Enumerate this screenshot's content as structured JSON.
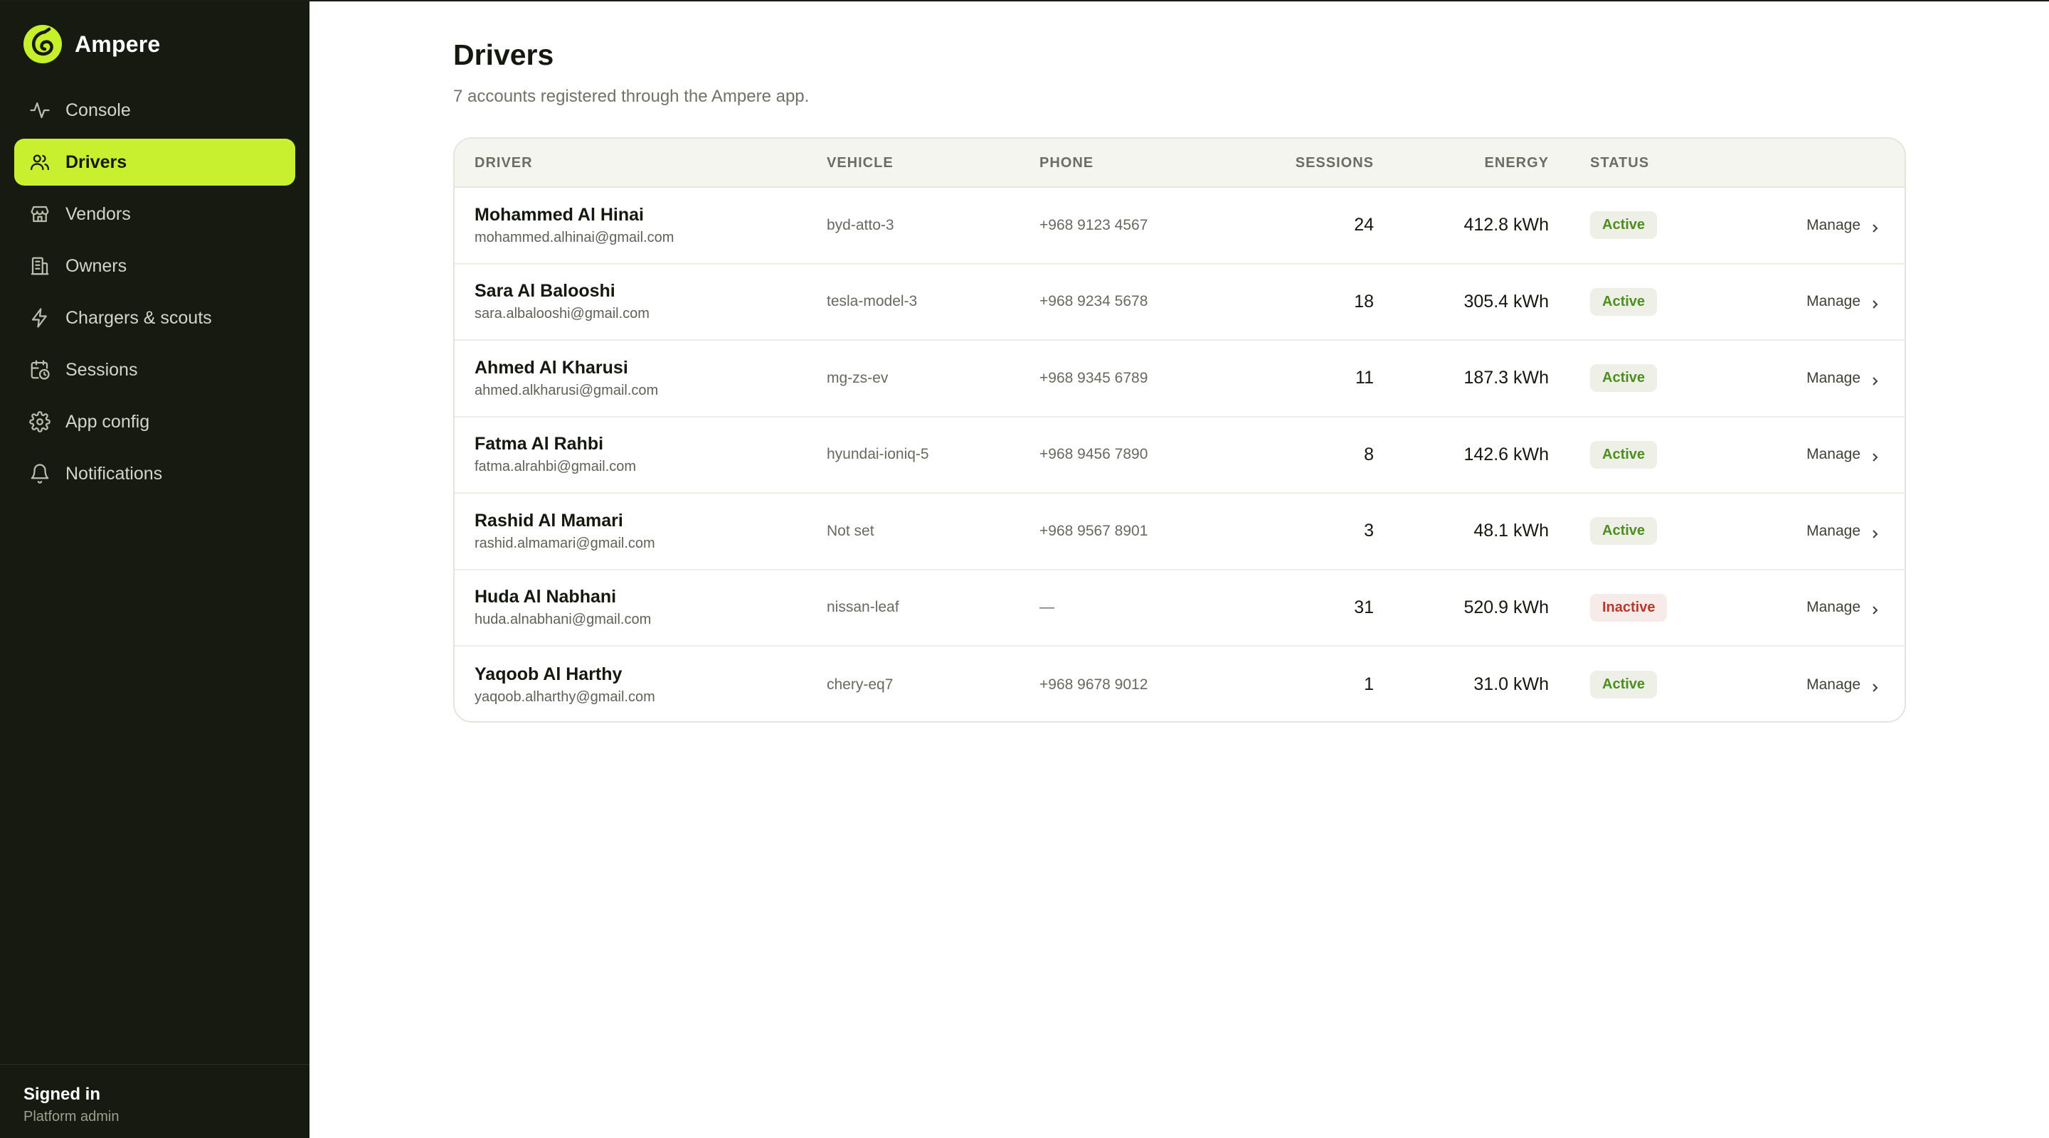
{
  "app": {
    "name": "Ampere"
  },
  "sidebar": {
    "items": [
      {
        "label": "Console",
        "icon": "activity-icon"
      },
      {
        "label": "Drivers",
        "icon": "users-icon",
        "active": true
      },
      {
        "label": "Vendors",
        "icon": "store-icon"
      },
      {
        "label": "Owners",
        "icon": "building-icon"
      },
      {
        "label": "Chargers & scouts",
        "icon": "bolt-icon"
      },
      {
        "label": "Sessions",
        "icon": "calendar-clock-icon"
      },
      {
        "label": "App config",
        "icon": "gear-icon"
      },
      {
        "label": "Notifications",
        "icon": "bell-icon"
      }
    ],
    "footer": {
      "title": "Signed in",
      "subtitle": "Platform admin"
    }
  },
  "page": {
    "title": "Drivers",
    "subtitle": "7 accounts registered through the Ampere app."
  },
  "table": {
    "columns": {
      "driver": "DRIVER",
      "vehicle": "VEHICLE",
      "phone": "PHONE",
      "sessions": "SESSIONS",
      "energy": "ENERGY",
      "status": "STATUS"
    },
    "action_label": "Manage",
    "rows": [
      {
        "name": "Mohammed Al Hinai",
        "email": "mohammed.alhinai@gmail.com",
        "vehicle": "byd-atto-3",
        "phone": "+968 9123 4567",
        "sessions": "24",
        "energy": "412.8 kWh",
        "status": "Active"
      },
      {
        "name": "Sara Al Balooshi",
        "email": "sara.albalooshi@gmail.com",
        "vehicle": "tesla-model-3",
        "phone": "+968 9234 5678",
        "sessions": "18",
        "energy": "305.4 kWh",
        "status": "Active"
      },
      {
        "name": "Ahmed Al Kharusi",
        "email": "ahmed.alkharusi@gmail.com",
        "vehicle": "mg-zs-ev",
        "phone": "+968 9345 6789",
        "sessions": "11",
        "energy": "187.3 kWh",
        "status": "Active"
      },
      {
        "name": "Fatma Al Rahbi",
        "email": "fatma.alrahbi@gmail.com",
        "vehicle": "hyundai-ioniq-5",
        "phone": "+968 9456 7890",
        "sessions": "8",
        "energy": "142.6 kWh",
        "status": "Active"
      },
      {
        "name": "Rashid Al Mamari",
        "email": "rashid.almamari@gmail.com",
        "vehicle": "Not set",
        "phone": "+968 9567 8901",
        "sessions": "3",
        "energy": "48.1 kWh",
        "status": "Active"
      },
      {
        "name": "Huda Al Nabhani",
        "email": "huda.alnabhani@gmail.com",
        "vehicle": "nissan-leaf",
        "phone": "—",
        "sessions": "31",
        "energy": "520.9 kWh",
        "status": "Inactive"
      },
      {
        "name": "Yaqoob Al Harthy",
        "email": "yaqoob.alharthy@gmail.com",
        "vehicle": "chery-eq7",
        "phone": "+968 9678 9012",
        "sessions": "1",
        "energy": "31.0 kWh",
        "status": "Active"
      }
    ]
  }
}
